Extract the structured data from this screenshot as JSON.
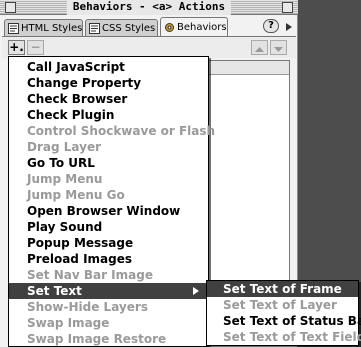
{
  "window": {
    "title": "Behaviors - <a> Actions"
  },
  "tabs": [
    {
      "label": "HTML Styles",
      "icon": "html-styles-icon",
      "active": false
    },
    {
      "label": "CSS Styles",
      "icon": "css-styles-icon",
      "active": false
    },
    {
      "label": "Behaviors",
      "icon": "behaviors-gear-icon",
      "active": true
    }
  ],
  "toolbar": {
    "add_label": "+.",
    "remove_label": "−"
  },
  "help": {
    "label": "?"
  },
  "menu": {
    "items": [
      {
        "label": "Call JavaScript",
        "enabled": true
      },
      {
        "label": "Change Property",
        "enabled": true
      },
      {
        "label": "Check Browser",
        "enabled": true
      },
      {
        "label": "Check Plugin",
        "enabled": true
      },
      {
        "label": "Control Shockwave or Flash",
        "enabled": false
      },
      {
        "label": "Drag Layer",
        "enabled": false
      },
      {
        "label": "Go To URL",
        "enabled": true
      },
      {
        "label": "Jump Menu",
        "enabled": false
      },
      {
        "label": "Jump Menu Go",
        "enabled": false
      },
      {
        "label": "Open Browser Window",
        "enabled": true
      },
      {
        "label": "Play Sound",
        "enabled": true
      },
      {
        "label": "Popup Message",
        "enabled": true
      },
      {
        "label": "Preload Images",
        "enabled": true
      },
      {
        "label": "Set Nav Bar Image",
        "enabled": false
      },
      {
        "label": "Set Text",
        "enabled": true,
        "selected": true,
        "has_submenu": true
      },
      {
        "label": "Show-Hide Layers",
        "enabled": false
      },
      {
        "label": "Swap Image",
        "enabled": false
      },
      {
        "label": "Swap Image Restore",
        "enabled": false
      }
    ]
  },
  "submenu": {
    "items": [
      {
        "label": "Set Text of Frame",
        "enabled": true,
        "selected": true
      },
      {
        "label": "Set Text of Layer",
        "enabled": false
      },
      {
        "label": "Set Text of Status Bar",
        "enabled": true
      },
      {
        "label": "Set Text of Text Field",
        "enabled": false
      }
    ]
  },
  "colors": {
    "highlight": "#404040",
    "disabled_text": "#9a9a9a",
    "desktop": "#4d4d4d"
  }
}
